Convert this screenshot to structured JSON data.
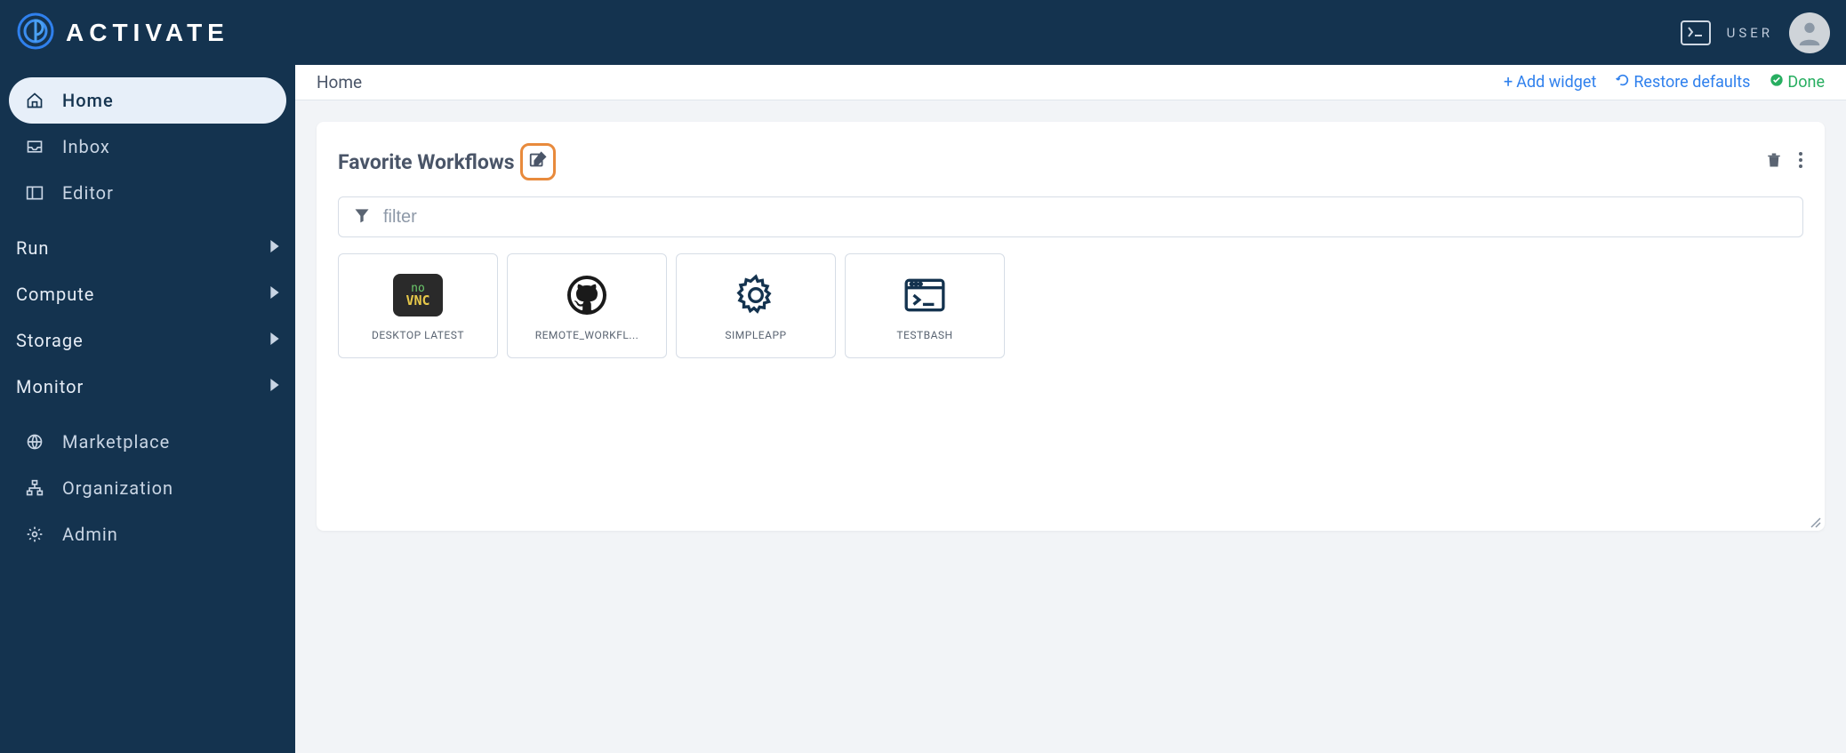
{
  "brand": {
    "name": "ACTIVATE"
  },
  "header": {
    "user_label": "USER"
  },
  "sidebar": {
    "items": [
      {
        "label": "Home",
        "icon": "home",
        "active": true
      },
      {
        "label": "Inbox",
        "icon": "inbox",
        "active": false
      },
      {
        "label": "Editor",
        "icon": "panel",
        "active": false
      }
    ],
    "groups": [
      {
        "label": "Run"
      },
      {
        "label": "Compute"
      },
      {
        "label": "Storage"
      },
      {
        "label": "Monitor"
      }
    ],
    "lower_items": [
      {
        "label": "Marketplace",
        "icon": "globe"
      },
      {
        "label": "Organization",
        "icon": "sitemap"
      },
      {
        "label": "Admin",
        "icon": "gear"
      }
    ]
  },
  "topbar": {
    "breadcrumb": "Home",
    "add_widget": "Add widget",
    "restore": "Restore defaults",
    "done": "Done"
  },
  "widget": {
    "title": "Favorite Workflows",
    "filter_placeholder": "filter",
    "workflows": [
      {
        "label": "DESKTOP LATEST",
        "icon": "novnc"
      },
      {
        "label": "REMOTE_WORKFL...",
        "icon": "github"
      },
      {
        "label": "SIMPLEAPP",
        "icon": "gear-outline"
      },
      {
        "label": "TESTBASH",
        "icon": "terminal-window"
      }
    ]
  }
}
